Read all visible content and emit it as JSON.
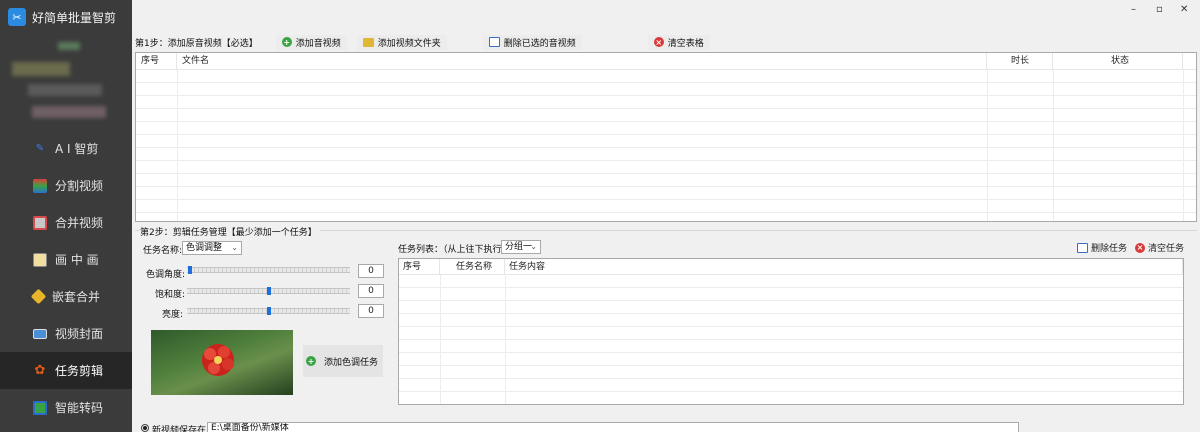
{
  "app": {
    "title": "好简单批量智剪"
  },
  "window": {
    "minimize": "–",
    "maximize": "▫",
    "close": "✕"
  },
  "sidebar": {
    "items": [
      {
        "label": "A I 智剪",
        "icon": "ai-icon",
        "active": false
      },
      {
        "label": "分割视频",
        "icon": "split-icon",
        "active": false
      },
      {
        "label": "合并视频",
        "icon": "merge-icon",
        "active": false
      },
      {
        "label": "画 中 画",
        "icon": "picture-in-picture-icon",
        "active": false
      },
      {
        "label": "嵌套合并",
        "icon": "nested-merge-icon",
        "active": false
      },
      {
        "label": "视频封面",
        "icon": "video-cover-icon",
        "active": false
      },
      {
        "label": "任务剪辑",
        "icon": "task-edit-icon",
        "active": true
      },
      {
        "label": "智能转码",
        "icon": "transcode-icon",
        "active": false
      }
    ]
  },
  "step1": {
    "label": "第1步：添加原音视频【必选】",
    "add_video": "添加音视频",
    "add_folder": "添加视频文件夹",
    "delete_selected": "删除已选的音视频",
    "clear_table": "清空表格"
  },
  "file_table": {
    "columns": [
      "序号",
      "文件名",
      "时长",
      "状态"
    ]
  },
  "step2": {
    "label": "第2步：剪辑任务管理【最少添加一个任务】",
    "task_name_label": "任务名称:",
    "task_name_value": "色调调整",
    "hue_label": "色调角度:",
    "hue_value": "0",
    "saturation_label": "饱和度:",
    "saturation_value": "0",
    "brightness_label": "亮度:",
    "brightness_value": "0",
    "add_task": "添加色调任务"
  },
  "sliders": {
    "hue_level": 0.0,
    "saturation_level": 0.5,
    "brightness_level": 0.5
  },
  "task_list": {
    "label": "任务列表：（从上往下执行）",
    "group_value": "分组一",
    "delete_task": "删除任务",
    "clear_tasks": "清空任务",
    "columns": [
      "序号",
      "任务名称",
      "任务内容"
    ]
  },
  "bottom": {
    "save_label": "新视频保存在:",
    "save_path": "E:\\桌面备份\\新媒体"
  }
}
